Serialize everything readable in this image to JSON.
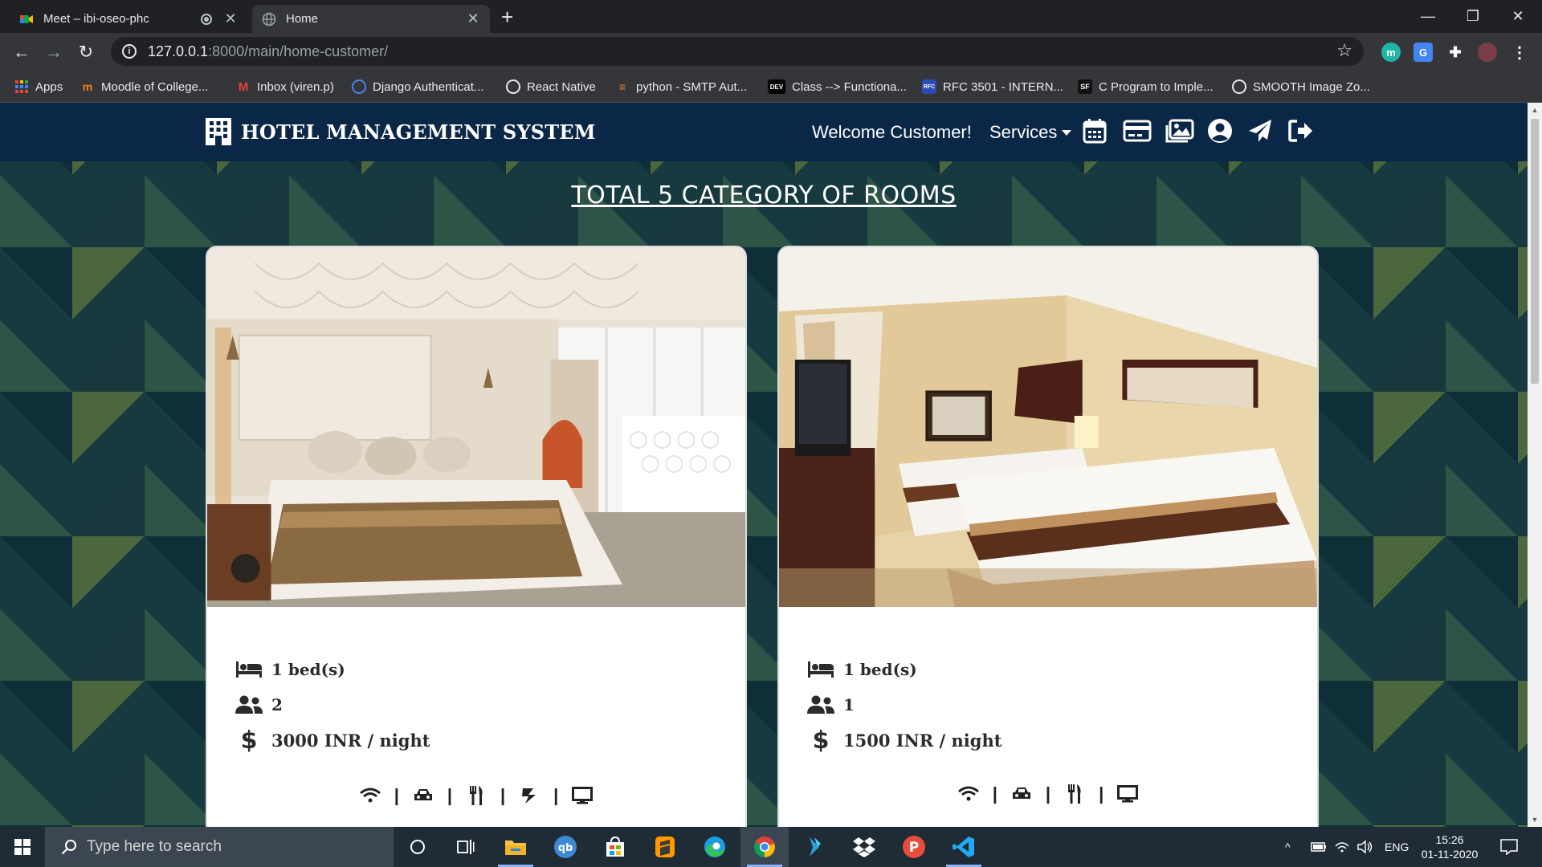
{
  "browser": {
    "tabs": [
      {
        "title": "Meet – ibi-oseo-phc",
        "active": false
      },
      {
        "title": "Home",
        "active": true
      }
    ],
    "url_host": "127.0.0.1",
    "url_path": ":8000/main/home-customer/",
    "bookmarks": [
      {
        "label": "Apps",
        "icon": "apps-grid-icon"
      },
      {
        "label": "Moodle of College...",
        "icon": "moodle-icon"
      },
      {
        "label": "Inbox (viren.p)",
        "icon": "gmail-icon"
      },
      {
        "label": "Django Authenticat...",
        "icon": "globe-icon"
      },
      {
        "label": "React Native",
        "icon": "globe-icon"
      },
      {
        "label": "python - SMTP Aut...",
        "icon": "stackoverflow-icon"
      },
      {
        "label": "Class --> Functiona...",
        "icon": "dev-icon"
      },
      {
        "label": "RFC 3501 - INTERN...",
        "icon": "rfc-icon"
      },
      {
        "label": "C Program to Imple...",
        "icon": "sf-icon"
      },
      {
        "label": "SMOOTH Image Zo...",
        "icon": "globe-icon"
      }
    ],
    "bookmark_badges": {
      "dev": "DEV",
      "rfc": "RFC",
      "sf": "SF"
    },
    "extension_badges": {
      "m": "m",
      "translate": "G"
    }
  },
  "site": {
    "brand": "HOTEL MANAGEMENT SYSTEM",
    "welcome": "Welcome Customer!",
    "services_label": "Services",
    "nav_icons": [
      "calendar-icon",
      "credit-card-icon",
      "gallery-icon",
      "user-circle-icon",
      "paper-plane-icon",
      "sign-out-icon"
    ],
    "heading": "TOTAL 5 CATEGORY OF ROOMS"
  },
  "rooms": [
    {
      "beds": "1 bed(s)",
      "guests": "2",
      "price": "3000 INR / night",
      "amenities": [
        "wifi-icon",
        "car-icon",
        "utensils-icon",
        "spa-icon",
        "tv-icon"
      ]
    },
    {
      "beds": "1 bed(s)",
      "guests": "1",
      "price": "1500 INR / night",
      "amenities": [
        "wifi-icon",
        "car-icon",
        "utensils-icon",
        "tv-icon"
      ]
    }
  ],
  "taskbar": {
    "search_placeholder": "Type here to search",
    "language": "ENG",
    "time": "15:26",
    "date": "01-11-2020"
  }
}
